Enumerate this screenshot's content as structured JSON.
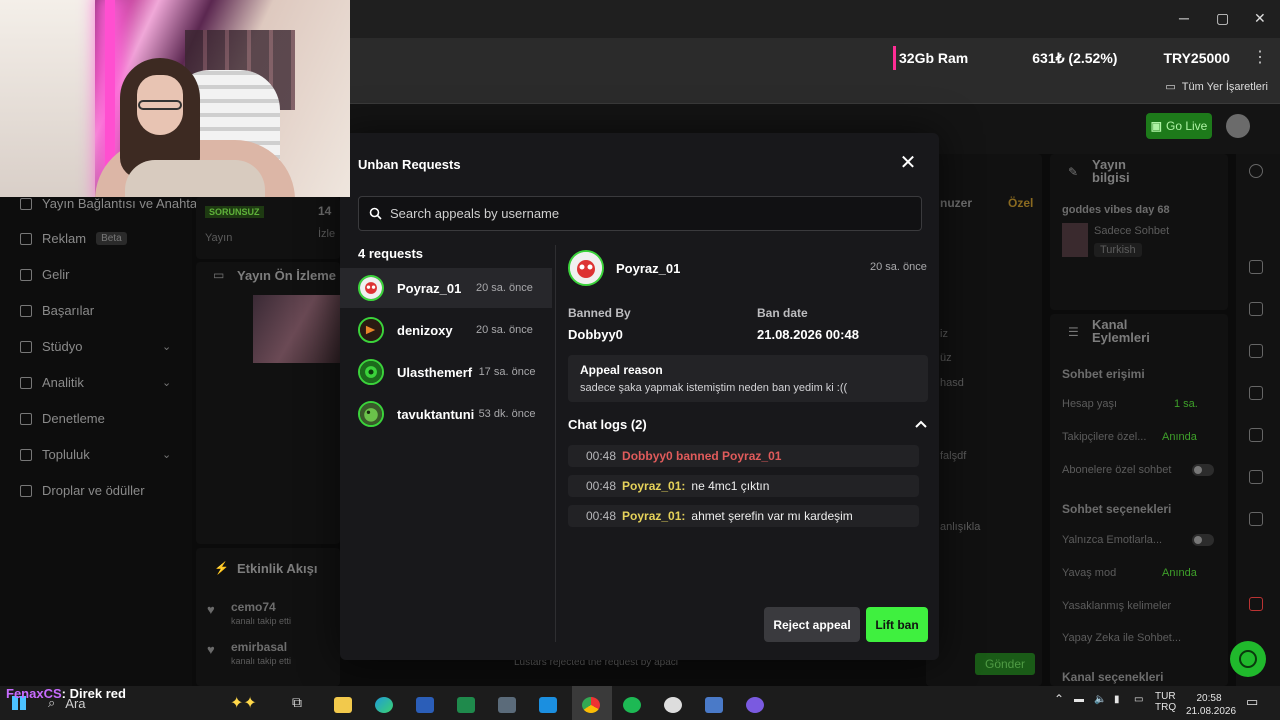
{
  "browser": {
    "ticker": [
      "32Gb Ram",
      "631₺ (2.52%)",
      "TRY25000"
    ],
    "bookmarks_all": "Tüm Yer İşaretleri",
    "go_live": "Go Live"
  },
  "sidebar": {
    "items": [
      {
        "label": "Yayın Bağlantısı ve Anahtarı",
        "icon": "link-icon"
      },
      {
        "label": "Reklam",
        "icon": "ad-icon",
        "badge": "Beta"
      },
      {
        "label": "Gelir",
        "icon": "revenue-icon"
      },
      {
        "label": "Başarılar",
        "icon": "trophy-icon"
      },
      {
        "label": "Stüdyo",
        "icon": "studio-icon"
      },
      {
        "label": "Analitik",
        "icon": "chart-icon"
      },
      {
        "label": "Denetleme",
        "icon": "shield-icon"
      },
      {
        "label": "Topluluk",
        "icon": "community-icon"
      },
      {
        "label": "Droplar ve ödüller",
        "icon": "gift-icon"
      }
    ]
  },
  "dashboard": {
    "sorunsuz": "SORUNSUZ",
    "yayin": "Yayın",
    "izle": "İzle",
    "stat": "14",
    "preview_title": "Yayın Ön İzleme",
    "activity_title": "Etkinlik Akışı",
    "activity": [
      {
        "name": "cemo74",
        "sub": "kanalı takip etti"
      },
      {
        "name": "emirbasal",
        "sub": "kanalı takip etti"
      }
    ],
    "stream_info_title": "Yayın bilgisi",
    "stream_name": "goddes vibes day 68",
    "category": "Sadece Sohbet",
    "language": "Turkish",
    "channel_actions_title": "Kanal Eylemleri",
    "chat_access": "Sohbet erişimi",
    "account_age": "Hesap yaşı",
    "account_age_val": "1 sa.",
    "followers_only": "Takipçilere özel...",
    "followers_only_val": "Anında",
    "subs_only": "Abonelere özel sohbet",
    "chat_options": "Sohbet seçenekleri",
    "emotes_only": "Yalnızca Emotlarla...",
    "slow_mode": "Yavaş mod",
    "slow_mode_val": "Anında",
    "banned_words": "Yasaklanmış kelimeler",
    "ai_chat": "Yapay Zeka ile Sohbet...",
    "channel_options": "Kanal seçenekleri",
    "chat_tab": "Özel",
    "chat_user": "nuzer",
    "chat_fragments": [
      "iz",
      "üz",
      "hasd",
      "falşdf",
      "anlışıkla"
    ],
    "send": "Gönder",
    "mod_line": "Lustars rejected the request by apaci"
  },
  "modal": {
    "title": "Unban Requests",
    "search_placeholder": "Search appeals by username",
    "count_label": "4 requests",
    "requests": [
      {
        "name": "Poyraz_01",
        "time": "20 sa. önce"
      },
      {
        "name": "denizoxy",
        "time": "20 sa. önce"
      },
      {
        "name": "Ulasthemerf",
        "time": "17 sa. önce"
      },
      {
        "name": "tavuktantuni",
        "time": "53 dk. önce"
      }
    ],
    "detail": {
      "name": "Poyraz_01",
      "time": "20 sa. önce",
      "banned_by_label": "Banned By",
      "banned_by": "Dobbyy0",
      "ban_date_label": "Ban date",
      "ban_date": "21.08.2026 00:48",
      "appeal_label": "Appeal reason",
      "appeal_text": "sadece şaka yapmak istemiştim neden ban yedim ki :((",
      "logs_label": "Chat logs (2)",
      "logs": [
        {
          "time": "00:48",
          "system": "Dobbyy0 banned Poyraz_01"
        },
        {
          "time": "00:48",
          "user": "Poyraz_01:",
          "msg": "ne 4mc1 çıktın"
        },
        {
          "time": "00:48",
          "user": "Poyraz_01:",
          "msg": "ahmet şerefin var mı kardeşim"
        }
      ]
    },
    "reject_label": "Reject appeal",
    "lift_label": "Lift ban"
  },
  "taskbar": {
    "search": "Ara",
    "chat_user": "FenaxCS",
    "chat_msg": ": Direk red",
    "lang1": "TUR",
    "lang2": "TRQ",
    "time": "20:58",
    "date": "21.08.2026"
  },
  "colors": {
    "accent_green": "#3ff03f",
    "system_red": "#e05b5b",
    "username_yellow": "#e6d25a",
    "ticker_pink": "#ff2d95"
  }
}
